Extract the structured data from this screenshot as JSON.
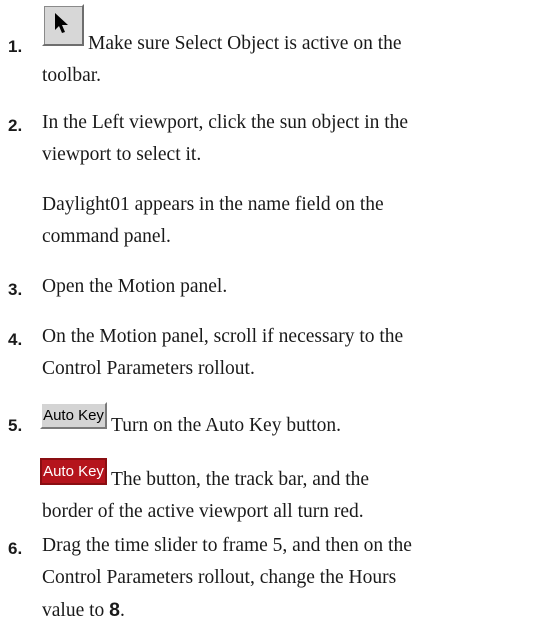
{
  "steps": [
    {
      "number": "1.",
      "text": "Make sure Select Object is active on the toolbar.",
      "line1": "Make sure Select Object is active on the",
      "line2": "toolbar.",
      "icon": "select-object-arrow-icon"
    },
    {
      "number": "2.",
      "line1": "In the Left viewport, click the sun object in the",
      "line2": "viewport to select it."
    },
    {
      "note": "Daylight01 appears in the name field on the command panel.",
      "note_line1": "Daylight01 appears in the name field on the",
      "note_line2": "command panel."
    },
    {
      "number": "3.",
      "line1": "Open the Motion panel."
    },
    {
      "number": "4.",
      "line1": "On the Motion panel, scroll if necessary to the",
      "line2": "Control Parameters rollout."
    },
    {
      "number": "5.",
      "line1": "Turn on the Auto Key button.",
      "button_label": "Auto Key"
    },
    {
      "note_line1": "The button, the track bar, and the",
      "note_line2": "border of the active viewport all turn red.",
      "button_label": "Auto Key",
      "button_color": "#b5141c"
    },
    {
      "number": "6.",
      "line1": "Drag the time slider to frame 5, and then on the",
      "line2": "Control Parameters rollout, change the Hours",
      "line3_prefix": "value to ",
      "line3_value": "8",
      "line3_suffix": "."
    }
  ]
}
